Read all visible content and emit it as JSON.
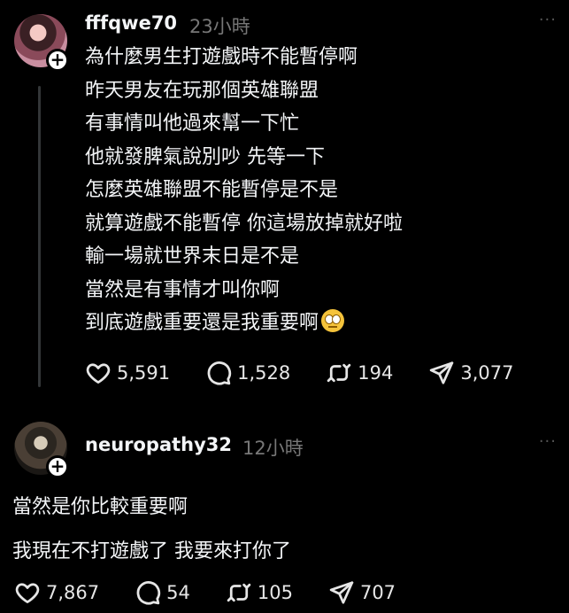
{
  "post1": {
    "username": "fffqwe70",
    "time": "23小時",
    "follow_glyph": "+",
    "more": "···",
    "lines": [
      "為什麼男生打遊戲時不能暫停啊",
      "昨天男友在玩那個英雄聯盟",
      "有事情叫他過來幫一下忙",
      "他就發脾氣說別吵 先等一下",
      "怎麼英雄聯盟不能暫停是不是",
      "就算遊戲不能暫停 你這場放掉就好啦",
      "輸一場就世界末日是不是",
      "當然是有事情才叫你啊",
      "到底遊戲重要還是我重要啊"
    ],
    "emoji": "eye-roll-emoji",
    "stats": {
      "likes": "5,591",
      "replies": "1,528",
      "reposts": "194",
      "shares": "3,077"
    }
  },
  "post2": {
    "username": "neuropathy32",
    "time": "12小時",
    "follow_glyph": "+",
    "more": "···",
    "lines": [
      "當然是你比較重要啊",
      "我現在不打遊戲了 我要來打你了"
    ],
    "stats": {
      "likes": "7,867",
      "replies": "54",
      "reposts": "105",
      "shares": "707"
    }
  },
  "icons": [
    "heart-icon",
    "comment-icon",
    "repost-icon",
    "share-icon"
  ],
  "colors": {
    "background": "#000000",
    "text": "#f3f5f7",
    "muted": "#777777",
    "emoji": "#f5c33b"
  }
}
